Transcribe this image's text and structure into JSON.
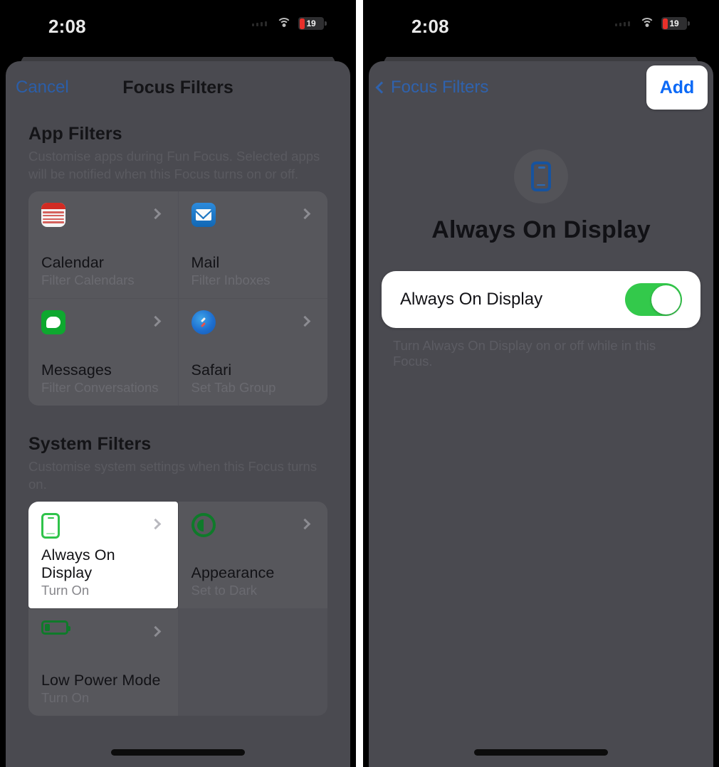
{
  "theme": {
    "sheet_bg": "#4a4a50",
    "card_bg": "rgba(255,255,255,0.035)",
    "accent_blue": "#0b69f6",
    "toggle_green": "#33c94b",
    "battery_red": "#e8302a"
  },
  "status_bar": {
    "time": "2:08",
    "wifi_icon": "wifi-icon",
    "battery_level": "19"
  },
  "left_screen": {
    "nav": {
      "cancel_label": "Cancel",
      "title": "Focus Filters"
    },
    "app_filters": {
      "title": "App Filters",
      "description": "Customise apps during Fun Focus. Selected apps will be notified when this Focus turns on or off.",
      "cards": [
        {
          "icon": "calendar-icon",
          "title": "Calendar",
          "subtitle": "Filter Calendars"
        },
        {
          "icon": "mail-icon",
          "title": "Mail",
          "subtitle": "Filter Inboxes"
        },
        {
          "icon": "messages-icon",
          "title": "Messages",
          "subtitle": "Filter Conversations"
        },
        {
          "icon": "safari-icon",
          "title": "Safari",
          "subtitle": "Set Tab Group"
        }
      ]
    },
    "system_filters": {
      "title": "System Filters",
      "description": "Customise system settings when this Focus turns on.",
      "cards": [
        {
          "icon": "always-on-display-icon",
          "title": "Always On Display",
          "subtitle": "Turn On",
          "highlighted": true
        },
        {
          "icon": "appearance-icon",
          "title": "Appearance",
          "subtitle": "Set to Dark",
          "highlighted": false
        },
        {
          "icon": "low-power-mode-icon",
          "title": "Low Power Mode",
          "subtitle": "Turn On",
          "highlighted": false
        }
      ]
    }
  },
  "right_screen": {
    "nav": {
      "back_label": "Focus Filters",
      "add_label": "Add"
    },
    "detail": {
      "hero_icon": "always-on-display-icon",
      "hero_title": "Always On Display",
      "toggle_label": "Always On Display",
      "toggle_state": "on",
      "footer_note": "Turn Always On Display on or off while in this Focus."
    }
  }
}
